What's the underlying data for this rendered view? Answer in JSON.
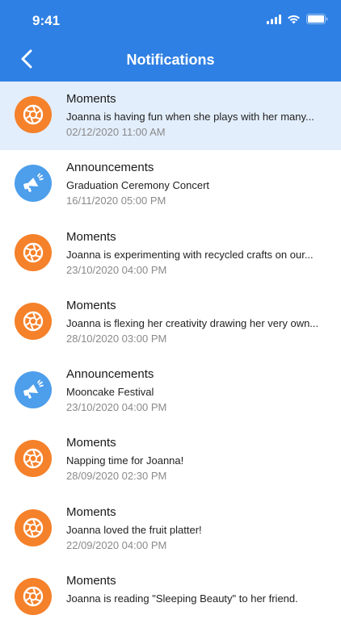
{
  "status_bar": {
    "time": "9:41"
  },
  "header": {
    "title": "Notifications",
    "back_icon": "chevron-left-icon"
  },
  "colors": {
    "header": "#2f80e4",
    "highlight": "#e3eefc",
    "moments": "#f5812a",
    "announcements": "#4d9eeb"
  },
  "notifications": [
    {
      "type": "moments",
      "icon": "camera-shutter-icon",
      "title": "Moments",
      "body": "Joanna is having fun when she plays with her many...",
      "date": "02/12/2020 11:00 AM",
      "highlighted": true
    },
    {
      "type": "announcements",
      "icon": "megaphone-icon",
      "title": "Announcements",
      "body": "Graduation Ceremony Concert",
      "date": "16/11/2020 05:00 PM",
      "highlighted": false
    },
    {
      "type": "moments",
      "icon": "camera-shutter-icon",
      "title": "Moments",
      "body": "Joanna is experimenting with recycled crafts on our...",
      "date": "23/10/2020 04:00 PM",
      "highlighted": false
    },
    {
      "type": "moments",
      "icon": "camera-shutter-icon",
      "title": "Moments",
      "body": "Joanna is flexing her creativity drawing her very own...",
      "date": "28/10/2020 03:00 PM",
      "highlighted": false
    },
    {
      "type": "announcements",
      "icon": "megaphone-icon",
      "title": "Announcements",
      "body": "Mooncake Festival",
      "date": "23/10/2020 04:00 PM",
      "highlighted": false
    },
    {
      "type": "moments",
      "icon": "camera-shutter-icon",
      "title": "Moments",
      "body": "Napping time for Joanna!",
      "date": "28/09/2020 02:30 PM",
      "highlighted": false
    },
    {
      "type": "moments",
      "icon": "camera-shutter-icon",
      "title": "Moments",
      "body": "Joanna loved the fruit platter!",
      "date": "22/09/2020 04:00 PM",
      "highlighted": false
    },
    {
      "type": "moments",
      "icon": "camera-shutter-icon",
      "title": "Moments",
      "body": "Joanna is reading \"Sleeping Beauty\" to her friend.",
      "date": "",
      "highlighted": false
    }
  ]
}
